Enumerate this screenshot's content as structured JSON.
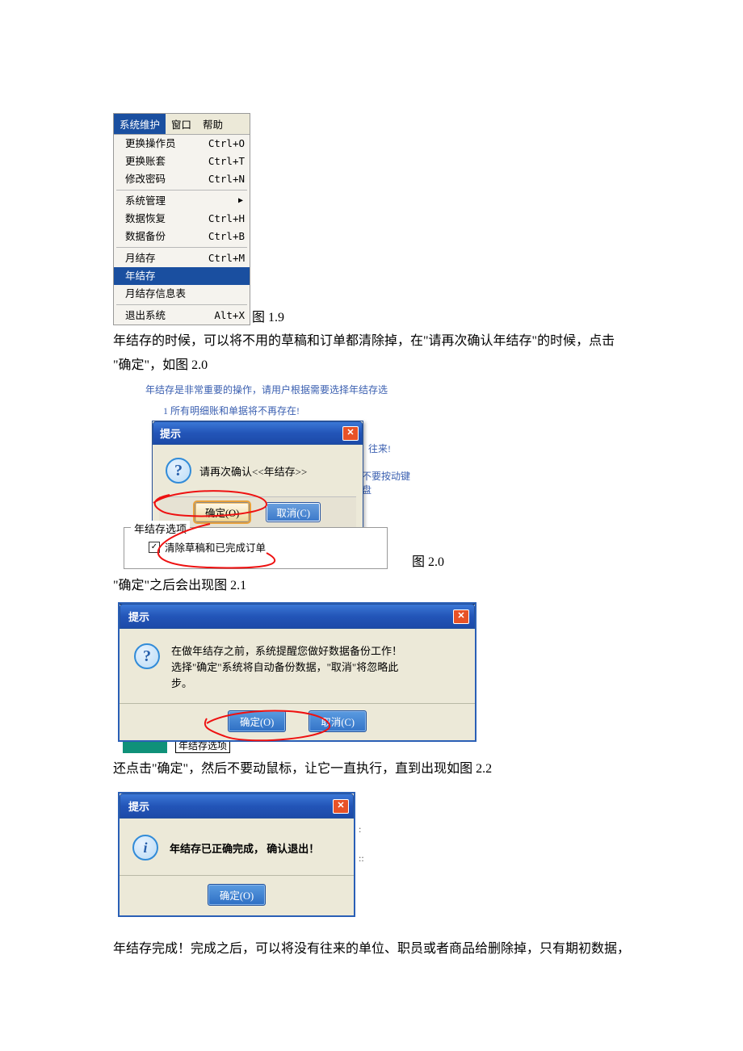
{
  "menubar": {
    "sys": "系统维护",
    "win": "窗口",
    "help": "帮助"
  },
  "menu": [
    {
      "label": "更换操作员",
      "shortcut": "Ctrl+O"
    },
    {
      "label": "更换账套",
      "shortcut": "Ctrl+T"
    },
    {
      "label": "修改密码",
      "shortcut": "Ctrl+N"
    },
    {
      "sep": true
    },
    {
      "label": "系统管理",
      "arrow": true
    },
    {
      "label": "数据恢复",
      "shortcut": "Ctrl+H"
    },
    {
      "label": "数据备份",
      "shortcut": "Ctrl+B"
    },
    {
      "sep": true
    },
    {
      "label": "月结存",
      "shortcut": "Ctrl+M"
    },
    {
      "label": "年结存",
      "highlight": true
    },
    {
      "label": "月结存信息表"
    },
    {
      "sep": true
    },
    {
      "label": "退出系统",
      "shortcut": "Alt+X"
    }
  ],
  "caption19": "图 1.9",
  "para1a": "年结存的时候，可以将不用的草稿和订单都清除掉，在\"请再次确认年结存\"的时候，点击",
  "para1b": "\"确定\"，如图 2.0",
  "fig20bg": {
    "l1": "年结存是非常重要的操作，请用户根据需要选择年结存选",
    "l2": "1 所有明细账和单据将不再存在!",
    "l3": "往来!",
    "l4": "不要按动键盘"
  },
  "dlg20": {
    "title": "提示",
    "msg": "请再次确认<<年结存>>",
    "ok": "确定(O)",
    "cancel": "取消(C)"
  },
  "groupbox": {
    "legend": "年结存选项",
    "chk": "清除草稿和已完成订单"
  },
  "caption20": "图 2.0",
  "para2": "\"确定\"之后会出现图 2.1",
  "dlg21": {
    "title": "提示",
    "l1": "在做年结存之前，系统提醒您做好数据备份工作！",
    "l2": "选择\"确定\"系统将自动备份数据，\"取消\"将忽略此",
    "l3": "步。",
    "ok": "确定(O)",
    "cancel": "取消(C)"
  },
  "fig21_groupbox_legend": "年结存选项",
  "para3": "还点击\"确定\"，然后不要动鼠标，让它一直执行，直到出现如图 2.2",
  "dlg22": {
    "title": "提示",
    "msg": "年结存已正确完成， 确认退出！",
    "ok": "确定(O)"
  },
  "para4": "年结存完成！完成之后，可以将没有往来的单位、职员或者商品给删除掉，只有期初数据，"
}
